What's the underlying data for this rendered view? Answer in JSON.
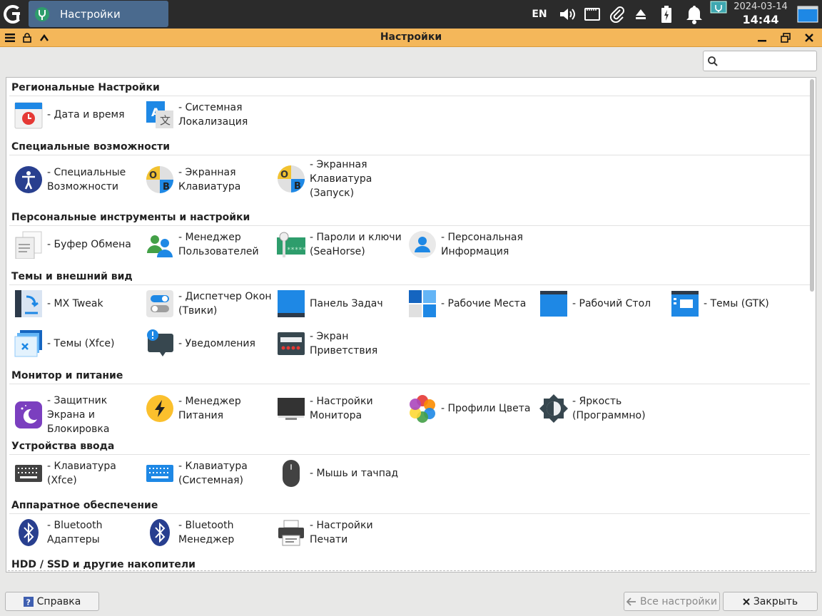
{
  "taskbar": {
    "task_label": "Настройки",
    "keyboard_layout": "EN",
    "date": "2024-03-14",
    "time": "14:44"
  },
  "window": {
    "title": "Настройки"
  },
  "search": {
    "placeholder": "",
    "value": ""
  },
  "sections": [
    {
      "title": "Региональные Настройки",
      "items": [
        "- Дата и время",
        "- Системная Локализация"
      ]
    },
    {
      "title": "Специальные возможности",
      "items": [
        "- Специальные Возможности",
        "- Экранная Клавиатура",
        "- Экранная Клавиатура (Запуск)"
      ]
    },
    {
      "title": "Персональные инструменты и настройки",
      "items": [
        "- Буфер Обмена",
        "- Менеджер Пользователей",
        "- Пароли и ключи (SeaHorse)",
        "- Персональная Информация"
      ]
    },
    {
      "title": "Темы и внешний вид",
      "items": [
        "- MX Tweak",
        "- Диспетчер Окон (Твики)",
        "Панель Задач",
        "- Рабочие Места",
        "- Рабочий Стол",
        "- Темы (GTK)",
        "- Темы (Xfce)",
        "- Уведомления",
        "- Экран Приветствия"
      ]
    },
    {
      "title": "Монитор и питание",
      "items": [
        "- Защитник Экрана и Блокировка",
        "- Менеджер Питания",
        "- Настройки Монитора",
        "- Профили Цвета",
        "- Яркость (Программно)"
      ]
    },
    {
      "title": "Устройства ввода",
      "items": [
        "- Клавиатура (Xfce)",
        "- Клавиатура (Системная)",
        "- Мышь и тачпад"
      ]
    },
    {
      "title": "Аппаратное обеспечение",
      "items": [
        "- Bluetooth Адаптеры",
        "- Bluetooth Менеджер",
        "- Настройки Печати"
      ]
    },
    {
      "title": "HDD / SSD и другие накопители",
      "items": []
    }
  ],
  "footer": {
    "help_label": "Справка",
    "all_settings_label": "Все настройки",
    "close_label": "Закрыть"
  },
  "colors": {
    "titlebar": "#f4b75a",
    "taskbar": "#2b2b2b",
    "active_task": "#4a6a8e",
    "accent_blue": "#1e88e5"
  }
}
